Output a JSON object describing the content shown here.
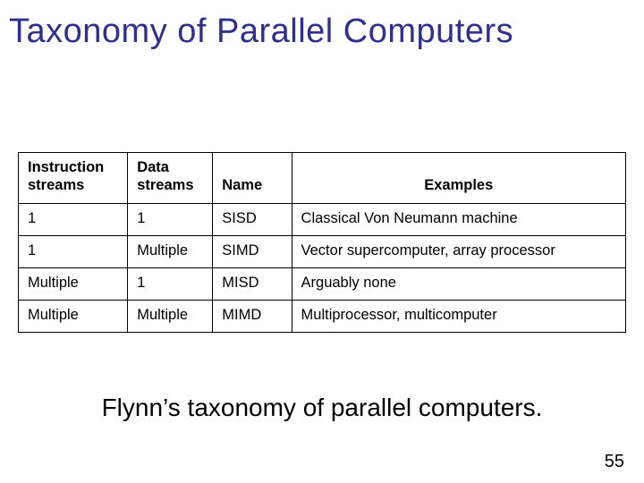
{
  "title": "Taxonomy of Parallel Computers",
  "table": {
    "headers": {
      "instruction": "Instruction streams",
      "data": "Data streams",
      "name": "Name",
      "examples": "Examples"
    },
    "rows": [
      {
        "instruction": "1",
        "data": "1",
        "name": "SISD",
        "examples": "Classical Von Neumann machine"
      },
      {
        "instruction": "1",
        "data": "Multiple",
        "name": "SIMD",
        "examples": "Vector supercomputer, array processor"
      },
      {
        "instruction": "Multiple",
        "data": "1",
        "name": "MISD",
        "examples": "Arguably none"
      },
      {
        "instruction": "Multiple",
        "data": "Multiple",
        "name": "MIMD",
        "examples": "Multiprocessor, multicomputer"
      }
    ]
  },
  "caption": "Flynn’s taxonomy of parallel computers.",
  "page_number": "55"
}
